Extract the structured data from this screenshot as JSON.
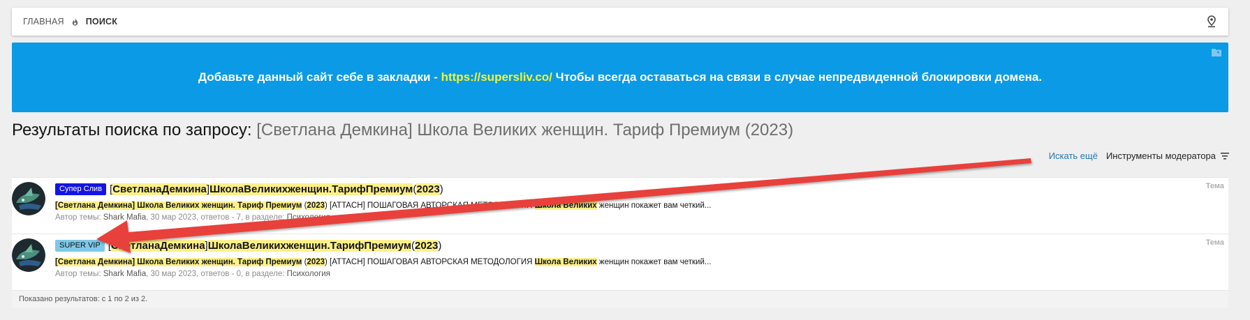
{
  "breadcrumb": {
    "home": "Главная",
    "current": "Поиск"
  },
  "notice": {
    "text_before": "Добавьте данный сайт себе в закладки - ",
    "link": "https://supersliv.co/",
    "text_after": " Чтобы всегда оставаться на связи в случае непредвиденной блокировки домена."
  },
  "page_title": {
    "prefix": "Результаты поиска по запросу: ",
    "query": "[Светлана Демкина] Школа Великих женщин. Тариф Премиум (2023)"
  },
  "actions": {
    "search_more": "Искать ещё",
    "mod_tools": "Инструменты модератора"
  },
  "results": [
    {
      "label": "Супер Слив",
      "title_parts": [
        "[",
        "Светлана",
        " ",
        "Демкина",
        "] ",
        "Школа",
        " ",
        "Великих",
        " ",
        "женщин.",
        " ",
        "Тариф",
        " ",
        "Премиум",
        " (",
        "2023",
        ")"
      ],
      "snippet_parts": [
        "[Светлана Демкина] Школа Великих женщин. Тариф Премиум",
        " (",
        "2023",
        ") [ATTACH] ПОШАГОВАЯ АВТОРСКАЯ МЕТОДОЛОГИЯ ",
        "Школа Великих",
        " женщин покажет вам четкий..."
      ],
      "meta_prefix": "Автор темы: ",
      "author": "Shark Mafia",
      "meta_rest": ", 30 мар 2023, ответов - 7, в разделе: ",
      "section": "Психология",
      "type": "Тема"
    },
    {
      "label": "SUPER VIP",
      "title_parts": [
        "[",
        "Светлана",
        " ",
        "Демкина",
        "] ",
        "Школа",
        " ",
        "Великих",
        " ",
        "женщин.",
        " ",
        "Тариф",
        " ",
        "Премиум",
        " (",
        "2023",
        ")"
      ],
      "snippet_parts": [
        "[Светлана Демкина] Школа Великих женщин. Тариф Премиум",
        " (",
        "2023",
        ") [ATTACH] ПОШАГОВАЯ АВТОРСКАЯ МЕТОДОЛОГИЯ ",
        "Школа Великих",
        " женщин покажет вам четкий..."
      ],
      "meta_prefix": "Автор темы: ",
      "author": "Shark Mafia",
      "meta_rest": ", 30 мар 2023, ответов - 0, в разделе: ",
      "section": "Психология",
      "type": "Тема"
    }
  ],
  "footer": "Показано результатов: с 1 по 2 из 2.",
  "colors": {
    "notice_bg": "#0a9ae6",
    "link_yellow": "#f5f52e",
    "highlight": "#fcf08a",
    "arrow": "#e8413b",
    "label_blue": "#1414e6",
    "label_cyan": "#7ec8e8"
  },
  "icons": {
    "breadcrumb_separator": "fire-icon",
    "location": "map-pin-icon",
    "notice_close": "folder-icon",
    "filter": "filter-icon",
    "annotation": "red-arrow-icon"
  }
}
